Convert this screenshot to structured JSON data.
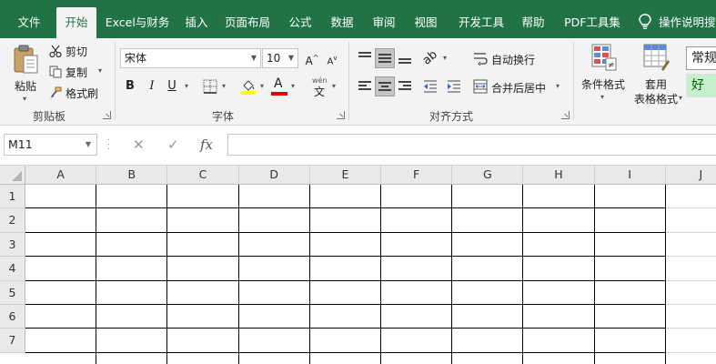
{
  "tabs": [
    "文件",
    "开始",
    "Excel与财务",
    "插入",
    "页面布局",
    "公式",
    "数据",
    "审阅",
    "视图",
    "开发工具",
    "帮助",
    "PDF工具集"
  ],
  "active_tab": "开始",
  "tell_me": "操作说明搜",
  "colors": {
    "brand": "#217346",
    "ribbon": "#f3f3f3",
    "good_fill": "#c6efce",
    "good_text": "#006100",
    "font_color": "#e00000",
    "fill_color": "#ffff00"
  },
  "clipboard": {
    "paste": "粘贴",
    "cut": "剪切",
    "copy": "复制",
    "format_painter": "格式刷",
    "group_label": "剪贴板"
  },
  "font": {
    "name": "宋体",
    "size": "10",
    "bold": "B",
    "italic": "I",
    "underline": "U",
    "grow": "A",
    "shrink": "A",
    "phonetic": "wén",
    "group_label": "字体"
  },
  "alignment": {
    "wrap_text": "自动换行",
    "merge_center": "合并后居中",
    "group_label": "对齐方式"
  },
  "styles": {
    "conditional": "条件格式",
    "table_line1": "套用",
    "table_line2": "表格格式",
    "style_normal": "常规",
    "style_good": "好"
  },
  "formula_bar": {
    "name_box": "M11",
    "cancel": "✕",
    "enter": "✓",
    "fx": "fx",
    "formula": ""
  },
  "grid": {
    "columns": [
      "A",
      "B",
      "C",
      "D",
      "E",
      "F",
      "G",
      "H",
      "I",
      "J"
    ],
    "rows": [
      "1",
      "2",
      "3",
      "4",
      "5",
      "6",
      "7"
    ]
  }
}
